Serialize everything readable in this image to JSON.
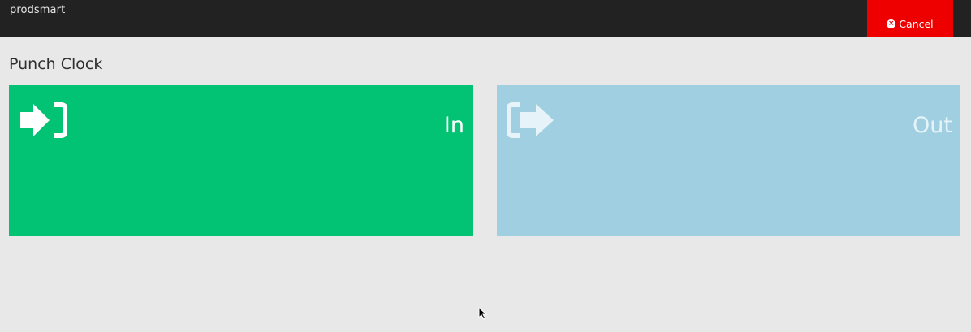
{
  "header": {
    "brand": "prodsmart",
    "cancel_label": "Cancel"
  },
  "page": {
    "title": "Punch Clock"
  },
  "tiles": [
    {
      "label": "In",
      "icon": "sign-in-icon",
      "color": "#02c373"
    },
    {
      "label": "Out",
      "icon": "sign-out-icon",
      "color": "#a0cfe1"
    }
  ],
  "colors": {
    "topbar": "#222222",
    "cancel": "#ee0000",
    "background": "#e8e8e8"
  }
}
